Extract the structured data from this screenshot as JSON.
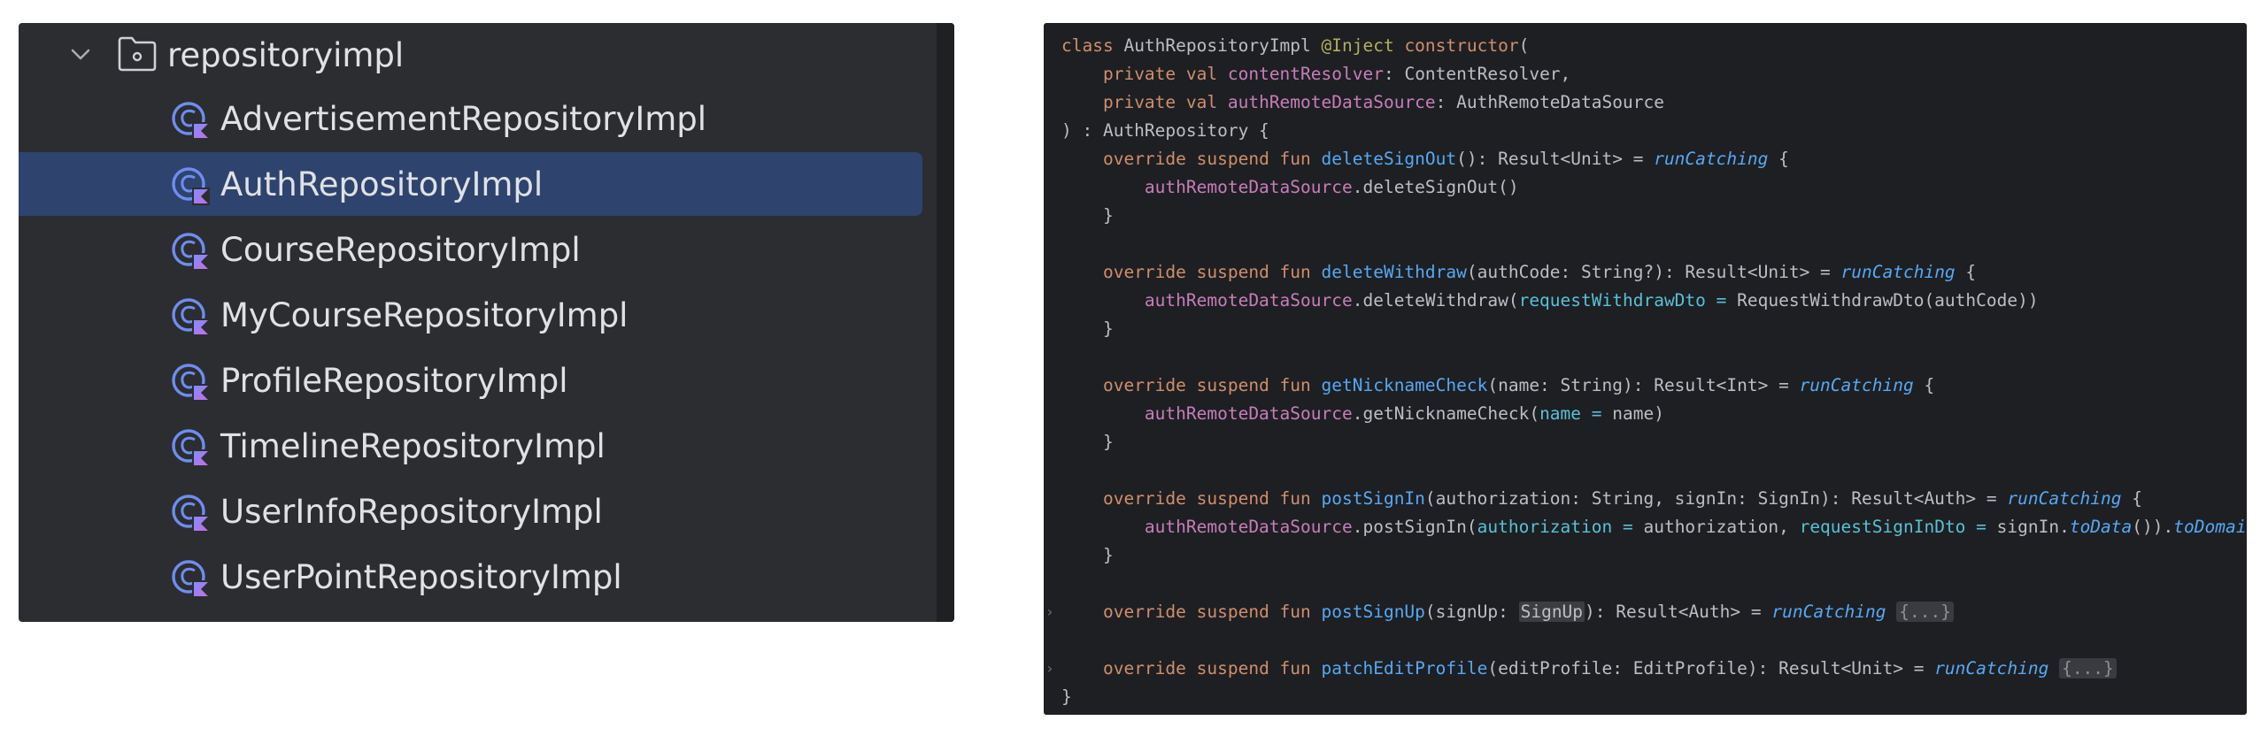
{
  "tree": {
    "folder": {
      "label": "repositoryimpl",
      "expanded": true
    },
    "files": [
      {
        "label": "AdvertisementRepositoryImpl",
        "selected": false
      },
      {
        "label": "AuthRepositoryImpl",
        "selected": true
      },
      {
        "label": "CourseRepositoryImpl",
        "selected": false
      },
      {
        "label": "MyCourseRepositoryImpl",
        "selected": false
      },
      {
        "label": "ProfileRepositoryImpl",
        "selected": false
      },
      {
        "label": "TimelineRepositoryImpl",
        "selected": false
      },
      {
        "label": "UserInfoRepositoryImpl",
        "selected": false
      },
      {
        "label": "UserPointRepositoryImpl",
        "selected": false
      }
    ]
  },
  "editor": {
    "lines": [
      {
        "tokens": [
          [
            "kw",
            "class "
          ],
          [
            "",
            "AuthRepositoryImpl "
          ],
          [
            "ann",
            "@Inject "
          ],
          [
            "kw",
            "constructor"
          ],
          [
            "",
            "("
          ]
        ]
      },
      {
        "tokens": [
          [
            "",
            "    "
          ],
          [
            "kw",
            "private val "
          ],
          [
            "prop",
            "contentResolver"
          ],
          [
            "",
            ": ContentResolver,"
          ]
        ]
      },
      {
        "tokens": [
          [
            "",
            "    "
          ],
          [
            "kw",
            "private val "
          ],
          [
            "prop",
            "authRemoteDataSource"
          ],
          [
            "",
            ": AuthRemoteDataSource"
          ]
        ]
      },
      {
        "tokens": [
          [
            "",
            ") : AuthRepository {"
          ]
        ]
      },
      {
        "tokens": [
          [
            "",
            "    "
          ],
          [
            "kw",
            "override suspend fun "
          ],
          [
            "fn",
            "deleteSignOut"
          ],
          [
            "",
            "(): Result<Unit> = "
          ],
          [
            "ital",
            "runCatching"
          ],
          [
            "",
            " {"
          ]
        ]
      },
      {
        "tokens": [
          [
            "",
            "        "
          ],
          [
            "prop",
            "authRemoteDataSource"
          ],
          [
            "",
            ".deleteSignOut()"
          ]
        ]
      },
      {
        "tokens": [
          [
            "",
            "    }"
          ]
        ]
      },
      {
        "tokens": []
      },
      {
        "tokens": [
          [
            "",
            "    "
          ],
          [
            "kw",
            "override suspend fun "
          ],
          [
            "fn",
            "deleteWithdraw"
          ],
          [
            "",
            "(authCode: String?): Result<Unit> = "
          ],
          [
            "ital",
            "runCatching"
          ],
          [
            "",
            " {"
          ]
        ]
      },
      {
        "tokens": [
          [
            "",
            "        "
          ],
          [
            "prop",
            "authRemoteDataSource"
          ],
          [
            "",
            ".deleteWithdraw("
          ],
          [
            "named",
            "requestWithdrawDto = "
          ],
          [
            "",
            "RequestWithdrawDto(authCode))"
          ]
        ]
      },
      {
        "tokens": [
          [
            "",
            "    }"
          ]
        ]
      },
      {
        "tokens": []
      },
      {
        "tokens": [
          [
            "",
            "    "
          ],
          [
            "kw",
            "override suspend fun "
          ],
          [
            "fn",
            "getNicknameCheck"
          ],
          [
            "",
            "(name: String): Result<Int> = "
          ],
          [
            "ital",
            "runCatching"
          ],
          [
            "",
            " {"
          ]
        ]
      },
      {
        "tokens": [
          [
            "",
            "        "
          ],
          [
            "prop",
            "authRemoteDataSource"
          ],
          [
            "",
            ".getNicknameCheck("
          ],
          [
            "named",
            "name = "
          ],
          [
            "",
            "name)"
          ]
        ]
      },
      {
        "tokens": [
          [
            "",
            "    }"
          ]
        ]
      },
      {
        "tokens": []
      },
      {
        "tokens": [
          [
            "",
            "    "
          ],
          [
            "kw",
            "override suspend fun "
          ],
          [
            "fn",
            "postSignIn"
          ],
          [
            "",
            "(authorization: String, signIn: SignIn): Result<Auth> = "
          ],
          [
            "ital",
            "runCatching"
          ],
          [
            "",
            " {"
          ]
        ]
      },
      {
        "tokens": [
          [
            "",
            "        "
          ],
          [
            "prop",
            "authRemoteDataSource"
          ],
          [
            "",
            ".postSignIn("
          ],
          [
            "named",
            "authorization = "
          ],
          [
            "",
            "authorization, "
          ],
          [
            "named",
            "requestSignInDto = "
          ],
          [
            "",
            "signIn."
          ],
          [
            "ital",
            "toData"
          ],
          [
            "",
            "())."
          ],
          [
            "ital",
            "toDomain"
          ],
          [
            "",
            "()"
          ]
        ]
      },
      {
        "tokens": [
          [
            "",
            "    }"
          ]
        ]
      },
      {
        "tokens": []
      },
      {
        "fold": true,
        "tokens": [
          [
            "",
            "    "
          ],
          [
            "kw",
            "override suspend fun "
          ],
          [
            "fn",
            "postSignUp"
          ],
          [
            "",
            "(signUp: "
          ],
          [
            "hl",
            "SignUp"
          ],
          [
            "",
            "): Result<Auth> = "
          ],
          [
            "ital",
            "runCatching"
          ],
          [
            "",
            " "
          ],
          [
            "foldbox",
            "{...}"
          ]
        ]
      },
      {
        "tokens": []
      },
      {
        "fold": true,
        "tokens": [
          [
            "",
            "    "
          ],
          [
            "kw",
            "override suspend fun "
          ],
          [
            "fn",
            "patchEditProfile"
          ],
          [
            "",
            "(editProfile: EditProfile): Result<Unit> = "
          ],
          [
            "ital",
            "runCatching"
          ],
          [
            "",
            " "
          ],
          [
            "foldbox",
            "{...}"
          ]
        ]
      },
      {
        "tokens": [
          [
            "",
            "}"
          ]
        ]
      }
    ],
    "fold_marker": "›"
  },
  "colors": {
    "tree_bg": "#2b2d30",
    "tree_selected": "#2e436e",
    "editor_bg": "#1e1f22",
    "keyword": "#cf8e6d",
    "function": "#56a8f5",
    "property": "#c77dbb",
    "annotation": "#b3ae60"
  },
  "icons": {
    "chevron": "chevron-down-icon",
    "folder": "package-folder-icon",
    "class": "kotlin-class-icon"
  }
}
